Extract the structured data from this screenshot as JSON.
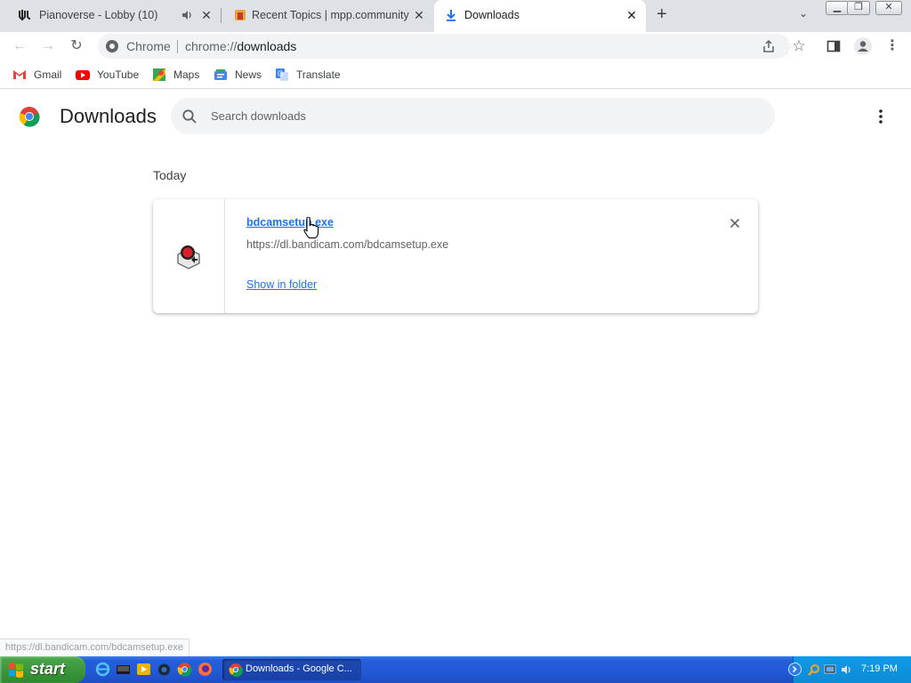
{
  "tabs": [
    {
      "title": "Pianoverse - Lobby (10)",
      "active": false,
      "audio": true
    },
    {
      "title": "Recent Topics | mpp.community",
      "active": false
    },
    {
      "title": "Downloads",
      "active": true
    }
  ],
  "omnibox": {
    "site_chip": "Chrome",
    "url_prefix": "chrome://",
    "url_host": "downloads"
  },
  "bookmarks": [
    {
      "label": "Gmail",
      "icon": "gmail-icon"
    },
    {
      "label": "YouTube",
      "icon": "youtube-icon"
    },
    {
      "label": "Maps",
      "icon": "maps-icon"
    },
    {
      "label": "News",
      "icon": "news-icon"
    },
    {
      "label": "Translate",
      "icon": "translate-icon"
    }
  ],
  "page": {
    "title": "Downloads",
    "search_placeholder": "Search downloads",
    "section": "Today"
  },
  "download": {
    "file_name": "bdcamsetup.exe",
    "url": "https://dl.bandicam.com/bdcamsetup.exe",
    "action": "Show in folder"
  },
  "status_url": "https://dl.bandicam.com/bdcamsetup.exe",
  "taskbar": {
    "start_label": "start",
    "task_label": "Downloads - Google C...",
    "clock": "7:19 PM"
  },
  "colors": {
    "tabstrip": "#dee1e6",
    "link": "#1a73e8",
    "taskbar": "#245edb",
    "start_button": "#3c963c"
  }
}
